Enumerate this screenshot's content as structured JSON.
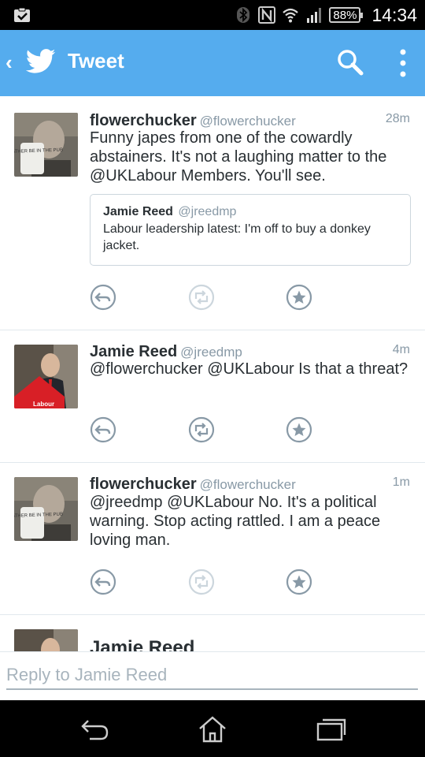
{
  "status_bar": {
    "battery": "88%",
    "time": "14:34"
  },
  "app_bar": {
    "title": "Tweet"
  },
  "tweets": [
    {
      "name": "flowerchucker",
      "handle": "@flowerchucker",
      "time": "28m",
      "text": "Funny japes from one of the cowardly abstainers. It's not a laughing matter to the @UKLabour Members. You'll see.",
      "quoted": {
        "name": "Jamie Reed",
        "handle": "@jreedmp",
        "text": "Labour leadership latest: I'm off to buy a donkey jacket."
      },
      "mug_text": "I'D RATHER BE IN THE PUB"
    },
    {
      "name": "Jamie Reed",
      "handle": "@jreedmp",
      "time": "4m",
      "text": "@flowerchucker @UKLabour Is that a threat?",
      "sign_text": "Labour"
    },
    {
      "name": "flowerchucker",
      "handle": "@flowerchucker",
      "time": "1m",
      "text": "@jreedmp @UKLabour No. It's a political warning. Stop acting rattled. I am a peace loving man.",
      "mug_text": "I'D RATHER BE IN THE PUB"
    },
    {
      "name": "Jamie Reed"
    }
  ],
  "reply": {
    "placeholder": "Reply to Jamie Reed"
  },
  "colors": {
    "brand": "#55acee",
    "action_icon": "#8899a6",
    "action_icon_disabled": "#ccd6dd"
  },
  "icons": {
    "back": "chevron-left-icon",
    "logo": "twitter-bird-icon",
    "search": "search-icon",
    "more": "overflow-menu-icon",
    "reply": "reply-icon",
    "retweet": "retweet-icon",
    "favorite": "favorite-star-icon"
  }
}
